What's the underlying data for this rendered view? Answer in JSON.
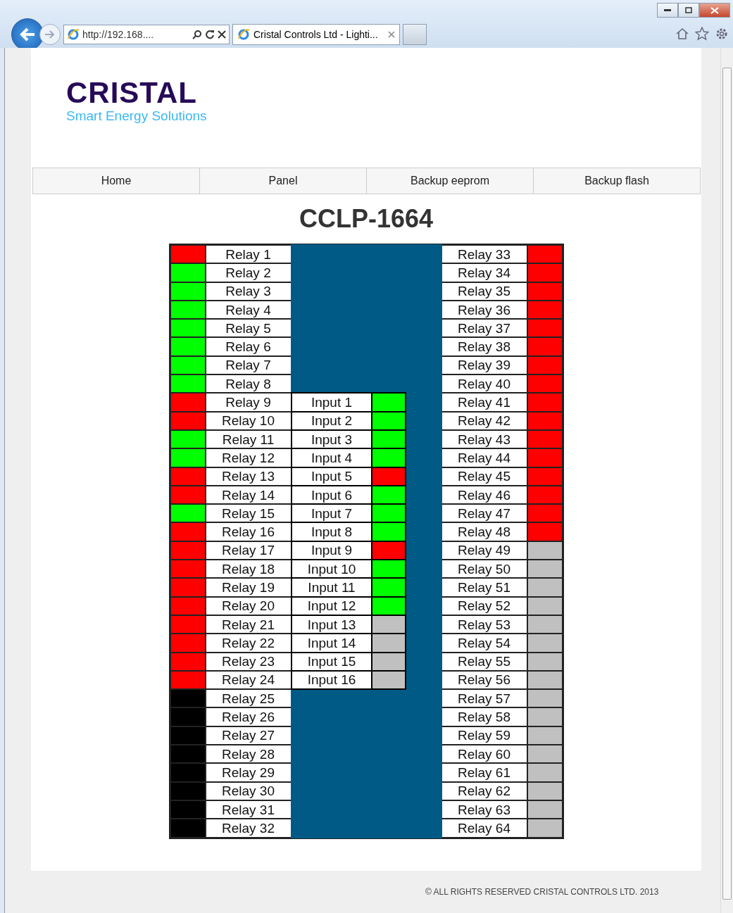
{
  "browser": {
    "address": "http://192.168....",
    "tab_title": "Cristal Controls Ltd - Lighti..."
  },
  "logo": {
    "name": "CRISTAL",
    "tagline": "Smart Energy Solutions"
  },
  "nav": [
    {
      "label": "Home"
    },
    {
      "label": "Panel"
    },
    {
      "label": "Backup eeprom"
    },
    {
      "label": "Backup flash"
    }
  ],
  "title": "CCLP-1664",
  "left_relays": [
    {
      "label": "Relay 1",
      "color": "#ff0000"
    },
    {
      "label": "Relay 2",
      "color": "#00ff00"
    },
    {
      "label": "Relay 3",
      "color": "#00ff00"
    },
    {
      "label": "Relay 4",
      "color": "#00ff00"
    },
    {
      "label": "Relay 5",
      "color": "#00ff00"
    },
    {
      "label": "Relay 6",
      "color": "#00ff00"
    },
    {
      "label": "Relay 7",
      "color": "#00ff00"
    },
    {
      "label": "Relay 8",
      "color": "#00ff00"
    },
    {
      "label": "Relay 9",
      "color": "#ff0000"
    },
    {
      "label": "Relay 10",
      "color": "#ff0000"
    },
    {
      "label": "Relay 11",
      "color": "#00ff00"
    },
    {
      "label": "Relay 12",
      "color": "#00ff00"
    },
    {
      "label": "Relay 13",
      "color": "#ff0000"
    },
    {
      "label": "Relay 14",
      "color": "#ff0000"
    },
    {
      "label": "Relay 15",
      "color": "#00ff00"
    },
    {
      "label": "Relay 16",
      "color": "#ff0000"
    },
    {
      "label": "Relay 17",
      "color": "#ff0000"
    },
    {
      "label": "Relay 18",
      "color": "#ff0000"
    },
    {
      "label": "Relay 19",
      "color": "#ff0000"
    },
    {
      "label": "Relay 20",
      "color": "#ff0000"
    },
    {
      "label": "Relay 21",
      "color": "#ff0000"
    },
    {
      "label": "Relay 22",
      "color": "#ff0000"
    },
    {
      "label": "Relay 23",
      "color": "#ff0000"
    },
    {
      "label": "Relay 24",
      "color": "#ff0000"
    },
    {
      "label": "Relay 25",
      "color": "#000000"
    },
    {
      "label": "Relay 26",
      "color": "#000000"
    },
    {
      "label": "Relay 27",
      "color": "#000000"
    },
    {
      "label": "Relay 28",
      "color": "#000000"
    },
    {
      "label": "Relay 29",
      "color": "#000000"
    },
    {
      "label": "Relay 30",
      "color": "#000000"
    },
    {
      "label": "Relay 31",
      "color": "#000000"
    },
    {
      "label": "Relay 32",
      "color": "#000000"
    }
  ],
  "inputs": [
    {
      "label": "Input 1",
      "color": "#00ff00"
    },
    {
      "label": "Input 2",
      "color": "#00ff00"
    },
    {
      "label": "Input 3",
      "color": "#00ff00"
    },
    {
      "label": "Input 4",
      "color": "#00ff00"
    },
    {
      "label": "Input 5",
      "color": "#ff0000"
    },
    {
      "label": "Input 6",
      "color": "#00ff00"
    },
    {
      "label": "Input 7",
      "color": "#00ff00"
    },
    {
      "label": "Input 8",
      "color": "#00ff00"
    },
    {
      "label": "Input 9",
      "color": "#ff0000"
    },
    {
      "label": "Input 10",
      "color": "#00ff00"
    },
    {
      "label": "Input 11",
      "color": "#00ff00"
    },
    {
      "label": "Input 12",
      "color": "#00ff00"
    },
    {
      "label": "Input 13",
      "color": "#c0c0c0"
    },
    {
      "label": "Input 14",
      "color": "#c0c0c0"
    },
    {
      "label": "Input 15",
      "color": "#c0c0c0"
    },
    {
      "label": "Input 16",
      "color": "#c0c0c0"
    }
  ],
  "right_relays": [
    {
      "label": "Relay 33",
      "color": "#ff0000"
    },
    {
      "label": "Relay 34",
      "color": "#ff0000"
    },
    {
      "label": "Relay 35",
      "color": "#ff0000"
    },
    {
      "label": "Relay 36",
      "color": "#ff0000"
    },
    {
      "label": "Relay 37",
      "color": "#ff0000"
    },
    {
      "label": "Relay 38",
      "color": "#ff0000"
    },
    {
      "label": "Relay 39",
      "color": "#ff0000"
    },
    {
      "label": "Relay 40",
      "color": "#ff0000"
    },
    {
      "label": "Relay 41",
      "color": "#ff0000"
    },
    {
      "label": "Relay 42",
      "color": "#ff0000"
    },
    {
      "label": "Relay 43",
      "color": "#ff0000"
    },
    {
      "label": "Relay 44",
      "color": "#ff0000"
    },
    {
      "label": "Relay 45",
      "color": "#ff0000"
    },
    {
      "label": "Relay 46",
      "color": "#ff0000"
    },
    {
      "label": "Relay 47",
      "color": "#ff0000"
    },
    {
      "label": "Relay 48",
      "color": "#ff0000"
    },
    {
      "label": "Relay 49",
      "color": "#c0c0c0"
    },
    {
      "label": "Relay 50",
      "color": "#c0c0c0"
    },
    {
      "label": "Relay 51",
      "color": "#c0c0c0"
    },
    {
      "label": "Relay 52",
      "color": "#c0c0c0"
    },
    {
      "label": "Relay 53",
      "color": "#c0c0c0"
    },
    {
      "label": "Relay 54",
      "color": "#c0c0c0"
    },
    {
      "label": "Relay 55",
      "color": "#c0c0c0"
    },
    {
      "label": "Relay 56",
      "color": "#c0c0c0"
    },
    {
      "label": "Relay 57",
      "color": "#c0c0c0"
    },
    {
      "label": "Relay 58",
      "color": "#c0c0c0"
    },
    {
      "label": "Relay 59",
      "color": "#c0c0c0"
    },
    {
      "label": "Relay 60",
      "color": "#c0c0c0"
    },
    {
      "label": "Relay 61",
      "color": "#c0c0c0"
    },
    {
      "label": "Relay 62",
      "color": "#c0c0c0"
    },
    {
      "label": "Relay 63",
      "color": "#c0c0c0"
    },
    {
      "label": "Relay 64",
      "color": "#c0c0c0"
    }
  ],
  "footer": "© ALL RIGHTS RESERVED CRISTAL CONTROLS LTD. 2013"
}
